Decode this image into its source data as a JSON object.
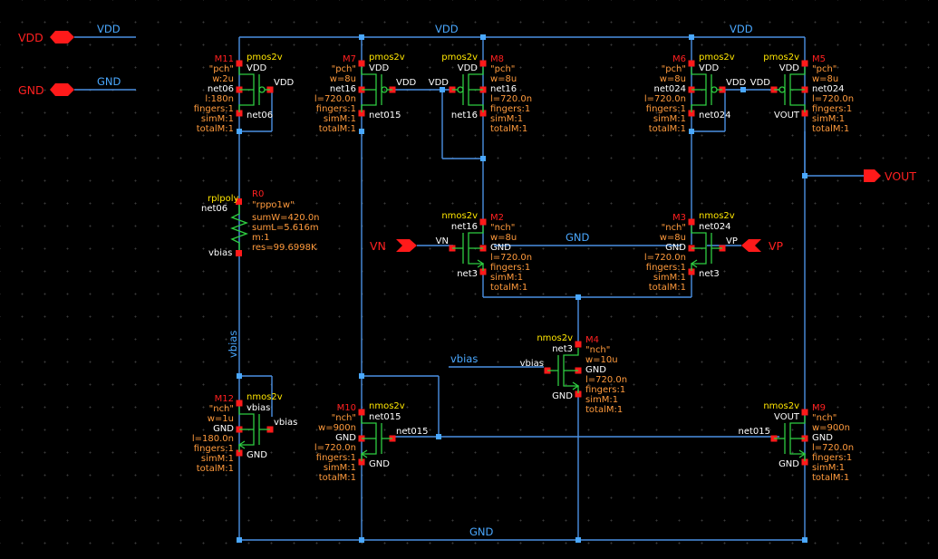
{
  "colors": {
    "background": "#000000",
    "wire": "#4a90e2",
    "device": "#2ecc40",
    "pin": "#ff1a1a",
    "instance_name": "#ff2020",
    "cell_name": "#ffe600",
    "param": "#ff9a3c",
    "terminal": "#ffffff",
    "net_label": "#4aa8ff"
  },
  "io_pins": {
    "vdd": "VDD",
    "gnd": "GND",
    "vout": "VOUT",
    "vn": "VN",
    "vp": "VP",
    "vdd_wire_label": "VDD",
    "gnd_wire_label": "GND"
  },
  "net_labels": {
    "vdd_top_left": "VDD",
    "vdd_top_right": "VDD",
    "gnd_mid": "GND",
    "gnd_bottom": "GND",
    "vbias_vertical": "vbias",
    "vbias_wire": "vbias"
  },
  "devices": {
    "M11": {
      "name": "M11",
      "cell": "pmos2v",
      "model": "\"pch\"",
      "p1": "w:2u",
      "p2": "l:180n",
      "p3": "fingers:1",
      "p4": "simM:1",
      "p5": "totalM:1",
      "t1": "VDD",
      "t2": "VDD",
      "t3": "net06",
      "t4": "net06"
    },
    "M7": {
      "name": "M7",
      "cell": "pmos2v",
      "model": "\"pch\"",
      "p1": "w=8u",
      "p2": "l=720.0n",
      "p3": "fingers:1",
      "p4": "simM:1",
      "p5": "totalM:1",
      "t1": "VDD",
      "t2": "VDD",
      "t3": "net16",
      "t4": "net015"
    },
    "M8": {
      "name": "M8",
      "cell": "pmos2v",
      "model": "\"pch\"",
      "p1": "w=8u",
      "p2": "l=720.0n",
      "p3": "fingers:1",
      "p4": "simM:1",
      "p5": "totalM:1",
      "t1": "VDD",
      "t2": "VDD",
      "t3": "net16",
      "t4": "net16"
    },
    "M6": {
      "name": "M6",
      "cell": "pmos2v",
      "model": "\"pch\"",
      "p1": "w=8u",
      "p2": "l=720.0n",
      "p3": "fingers:1",
      "p4": "simM:1",
      "p5": "totalM:1",
      "t1": "VDD",
      "t2": "VDD",
      "t3": "net024",
      "t4": "net024"
    },
    "M5": {
      "name": "M5",
      "cell": "pmos2v",
      "model": "\"pch\"",
      "p1": "w=8u",
      "p2": "l=720.0n",
      "p3": "fingers:1",
      "p4": "simM:1",
      "p5": "totalM:1",
      "t1": "VDD",
      "t2": "VDD",
      "t3": "net024",
      "t4": "VOUT"
    },
    "M2": {
      "name": "M2",
      "cell": "nmos2v",
      "model": "\"nch\"",
      "p1": "w=8u",
      "p2": "l=720.0n",
      "p3": "fingers:1",
      "p4": "simM:1",
      "p5": "totalM:1",
      "t1": "net16",
      "t2": "VN",
      "t3": "GND",
      "t4": "net3"
    },
    "M3": {
      "name": "M3",
      "cell": "nmos2v",
      "model": "\"nch\"",
      "p1": "w=8u",
      "p2": "l=720.0n",
      "p3": "fingers:1",
      "p4": "simM:1",
      "p5": "totalM:1",
      "t1": "net024",
      "t2": "VP",
      "t3": "GND",
      "t4": "net3"
    },
    "M4": {
      "name": "M4",
      "cell": "nmos2v",
      "model": "\"nch\"",
      "p1": "w=10u",
      "p2": "l=720.0n",
      "p3": "fingers:1",
      "p4": "simM:1",
      "p5": "totalM:1",
      "t1": "net3",
      "t2": "vbias",
      "t3": "GND",
      "t4": "GND"
    },
    "M12": {
      "name": "M12",
      "cell": "nmos2v",
      "model": "\"nch\"",
      "p1": "w=1u",
      "p2": "l=180.0n",
      "p3": "fingers:1",
      "p4": "simM:1",
      "p5": "totalM:1",
      "t1": "vbias",
      "t2": "vbias",
      "t3": "GND",
      "t4": "GND"
    },
    "M10": {
      "name": "M10",
      "cell": "nmos2v",
      "model": "\"nch\"",
      "p1": "w=900n",
      "p2": "l=720.0n",
      "p3": "fingers:1",
      "p4": "simM:1",
      "p5": "totalM:1",
      "t1": "net015",
      "t2": "net015",
      "t3": "GND",
      "t4": "GND"
    },
    "M9": {
      "name": "M9",
      "cell": "nmos2v",
      "model": "\"nch\"",
      "p1": "w=900n",
      "p2": "l=720.0n",
      "p3": "fingers:1",
      "p4": "simM:1",
      "p5": "totalM:1",
      "t1": "VOUT",
      "t2": "net015",
      "t3": "GND",
      "t4": "GND"
    },
    "R0": {
      "name": "R0",
      "cell": "rplpoly",
      "model": "\"rppo1w\"",
      "p1": "sumW=420.0n",
      "p2": "sumL=5.616m",
      "p3": "m:1",
      "p4": "res=99.6998K",
      "t1": "net06",
      "t2": "vbias"
    }
  }
}
